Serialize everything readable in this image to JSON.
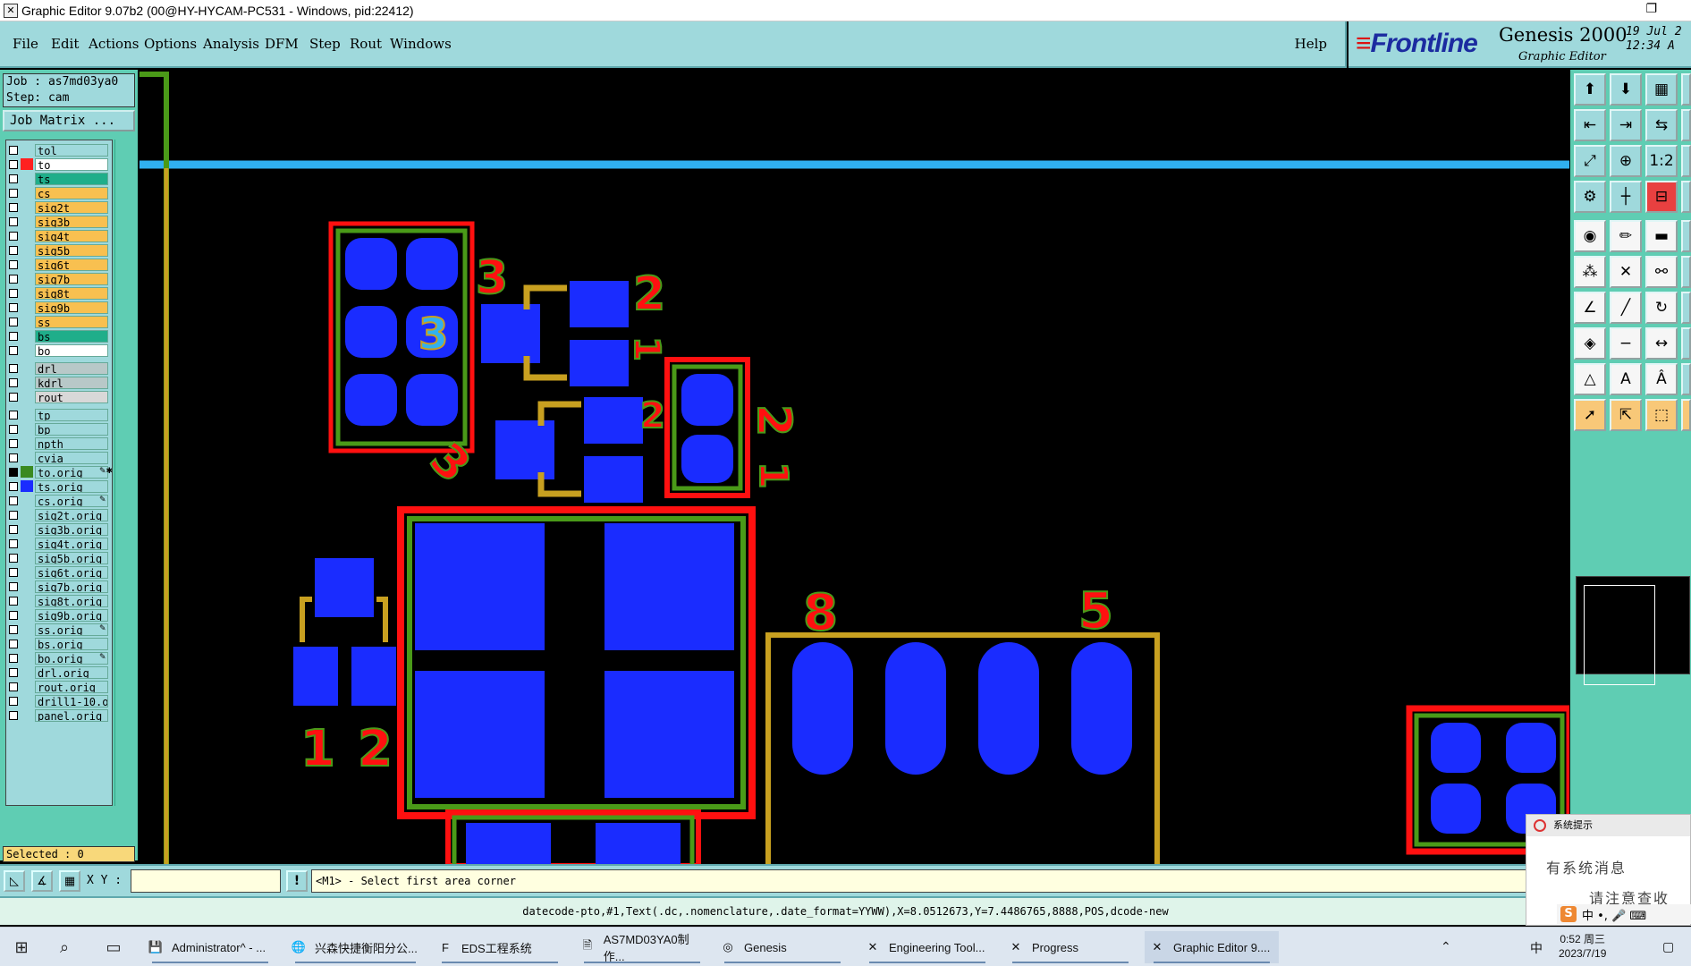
{
  "window": {
    "title": "Graphic Editor 9.07b2 (00@HY-HYCAM-PC531 - Windows, pid:22412)",
    "app_icon": "x-cross-icon",
    "restore_glyph": "❐"
  },
  "menu": {
    "items": [
      {
        "label": "File"
      },
      {
        "label": "Edit"
      },
      {
        "label": "Actions"
      },
      {
        "label": "Options"
      },
      {
        "label": "Analysis"
      },
      {
        "label": "DFM"
      },
      {
        "label": "Step"
      },
      {
        "label": "Rout"
      },
      {
        "label": "Windows"
      }
    ],
    "help": "Help"
  },
  "brand": {
    "logo": "Frontline",
    "product": "Genesis 2000",
    "subtitle": "Graphic Editor",
    "date_line1": "19 Jul 2",
    "date_line2": "12:34 A"
  },
  "left": {
    "job_line": "Job : as7md03ya0",
    "step_line": "Step: cam",
    "matrix_button": "Job Matrix ...",
    "selected": "Selected : 0",
    "layers": [
      {
        "name": "tol",
        "bg": "#9fd9dc",
        "swatch": "#9fd9dc",
        "checked": false
      },
      {
        "name": "to",
        "bg": "#ffffff",
        "swatch": "#ff2020",
        "checked": false
      },
      {
        "name": "ts",
        "bg": "#1fae8a",
        "swatch": "#9fd9dc",
        "checked": false
      },
      {
        "name": "cs",
        "bg": "#f8c050",
        "swatch": "#9fd9dc",
        "checked": false
      },
      {
        "name": "sig2t",
        "bg": "#f8c050",
        "swatch": "#9fd9dc",
        "checked": false
      },
      {
        "name": "sig3b",
        "bg": "#f8c050",
        "swatch": "#9fd9dc",
        "checked": false
      },
      {
        "name": "sig4t",
        "bg": "#f8c050",
        "swatch": "#9fd9dc",
        "checked": false
      },
      {
        "name": "sig5b",
        "bg": "#f8c050",
        "swatch": "#9fd9dc",
        "checked": false
      },
      {
        "name": "sig6t",
        "bg": "#f8c050",
        "swatch": "#9fd9dc",
        "checked": false
      },
      {
        "name": "sig7b",
        "bg": "#f8c050",
        "swatch": "#9fd9dc",
        "checked": false
      },
      {
        "name": "sig8t",
        "bg": "#f8c050",
        "swatch": "#9fd9dc",
        "checked": false
      },
      {
        "name": "sig9b",
        "bg": "#f8c050",
        "swatch": "#9fd9dc",
        "checked": false
      },
      {
        "name": "ss",
        "bg": "#f8c050",
        "swatch": "#9fd9dc",
        "checked": false
      },
      {
        "name": "bs",
        "bg": "#1fae8a",
        "swatch": "#9fd9dc",
        "checked": false
      },
      {
        "name": "bo",
        "bg": "#ffffff",
        "swatch": "#9fd9dc",
        "checked": false
      },
      {
        "name": "drl",
        "bg": "#b8c8c8",
        "swatch": "#9fd9dc",
        "checked": false,
        "gap": true
      },
      {
        "name": "kdrl",
        "bg": "#b8c8c8",
        "swatch": "#9fd9dc",
        "checked": false
      },
      {
        "name": "rout",
        "bg": "#d8d8d8",
        "swatch": "#9fd9dc",
        "checked": false
      },
      {
        "name": "tp",
        "bg": "#9fd9dc",
        "swatch": "#9fd9dc",
        "checked": false,
        "gap": true
      },
      {
        "name": "bp",
        "bg": "#9fd9dc",
        "swatch": "#9fd9dc",
        "checked": false
      },
      {
        "name": "npth",
        "bg": "#9fd9dc",
        "swatch": "#9fd9dc",
        "checked": false
      },
      {
        "name": "cvia",
        "bg": "#9fd9dc",
        "swatch": "#9fd9dc",
        "checked": false
      },
      {
        "name": "to.orig",
        "bg": "#9fd9dc",
        "swatch": "#3a8a20",
        "checked": true,
        "mark": "✎✱"
      },
      {
        "name": "ts.orig",
        "bg": "#9fd9dc",
        "swatch": "#1a2cff",
        "checked": false
      },
      {
        "name": "cs.orig",
        "bg": "#9fd9dc",
        "swatch": "#9fd9dc",
        "checked": false,
        "mark": "✎"
      },
      {
        "name": "sig2t.orig",
        "bg": "#9fd9dc",
        "swatch": "#9fd9dc",
        "checked": false
      },
      {
        "name": "sig3b.orig",
        "bg": "#9fd9dc",
        "swatch": "#9fd9dc",
        "checked": false
      },
      {
        "name": "sig4t.orig",
        "bg": "#9fd9dc",
        "swatch": "#9fd9dc",
        "checked": false
      },
      {
        "name": "sig5b.orig",
        "bg": "#9fd9dc",
        "swatch": "#9fd9dc",
        "checked": false
      },
      {
        "name": "sig6t.orig",
        "bg": "#9fd9dc",
        "swatch": "#9fd9dc",
        "checked": false
      },
      {
        "name": "sig7b.orig",
        "bg": "#9fd9dc",
        "swatch": "#9fd9dc",
        "checked": false
      },
      {
        "name": "sig8t.orig",
        "bg": "#9fd9dc",
        "swatch": "#9fd9dc",
        "checked": false
      },
      {
        "name": "sig9b.orig",
        "bg": "#9fd9dc",
        "swatch": "#9fd9dc",
        "checked": false
      },
      {
        "name": "ss.orig",
        "bg": "#9fd9dc",
        "swatch": "#9fd9dc",
        "checked": false,
        "mark": "✎"
      },
      {
        "name": "bs.orig",
        "bg": "#9fd9dc",
        "swatch": "#9fd9dc",
        "checked": false
      },
      {
        "name": "bo.orig",
        "bg": "#9fd9dc",
        "swatch": "#9fd9dc",
        "checked": false,
        "mark": "✎"
      },
      {
        "name": "drl.orig",
        "bg": "#9fd9dc",
        "swatch": "#9fd9dc",
        "checked": false
      },
      {
        "name": "rout.orig",
        "bg": "#9fd9dc",
        "swatch": "#9fd9dc",
        "checked": false
      },
      {
        "name": "drill1-10.o",
        "bg": "#9fd9dc",
        "swatch": "#9fd9dc",
        "checked": false
      },
      {
        "name": "panel.orig",
        "bg": "#9fd9dc",
        "swatch": "#9fd9dc",
        "checked": false
      }
    ]
  },
  "canvas": {
    "pin_numbers": [
      "3",
      "2",
      "1",
      "2",
      "3",
      "2",
      "1",
      "3",
      "8",
      "5",
      "1",
      "2"
    ],
    "colors": {
      "pad": "#1a2cff",
      "solder_mask": "#ff1010",
      "silkscreen": "#c8a020",
      "overlay": "#4a9a18",
      "ruler": "#30b0f0"
    }
  },
  "righttoolbar": {
    "buttons": [
      {
        "icon": "layer-up-icon",
        "glyph": "⬆"
      },
      {
        "icon": "layer-down-icon",
        "glyph": "⬇"
      },
      {
        "icon": "grid-icon",
        "glyph": "▦"
      },
      {
        "icon": "flip-left-icon",
        "glyph": "⇤"
      },
      {
        "icon": "flip-right-icon",
        "glyph": "⇥"
      },
      {
        "icon": "mirror-icon",
        "glyph": "⇆"
      },
      {
        "icon": "fit-icon",
        "glyph": "⤢"
      },
      {
        "icon": "zoom-icon",
        "glyph": "⊕"
      },
      {
        "icon": "scale-1-2-icon",
        "glyph": "1:2"
      },
      {
        "icon": "tools-icon",
        "glyph": "⚙"
      },
      {
        "icon": "cross-grid-icon",
        "glyph": "┼"
      },
      {
        "icon": "measure-icon",
        "glyph": "⊟"
      },
      {
        "icon": "camera-icon",
        "glyph": "◉"
      },
      {
        "icon": "pen-icon",
        "glyph": "✏"
      },
      {
        "icon": "ruler-icon",
        "glyph": "▬"
      },
      {
        "icon": "node-icon",
        "glyph": "⁂"
      },
      {
        "icon": "cross-icon",
        "glyph": "✕"
      },
      {
        "icon": "link-icon",
        "glyph": "⚯"
      },
      {
        "icon": "angle-icon",
        "glyph": "∠"
      },
      {
        "icon": "line-icon",
        "glyph": "╱"
      },
      {
        "icon": "arc-icon",
        "glyph": "↻"
      },
      {
        "icon": "pad-add-icon",
        "glyph": "◈"
      },
      {
        "icon": "minus-icon",
        "glyph": "−"
      },
      {
        "icon": "width-icon",
        "glyph": "↔"
      },
      {
        "icon": "triangle-icon",
        "glyph": "△"
      },
      {
        "icon": "text-a-icon",
        "glyph": "A"
      },
      {
        "icon": "text-a2-icon",
        "glyph": "Â"
      },
      {
        "icon": "pointer-icon",
        "glyph": "➚"
      },
      {
        "icon": "select-icon",
        "glyph": "⇱"
      },
      {
        "icon": "select-area-icon",
        "glyph": "⬚"
      }
    ]
  },
  "command": {
    "xy_label": "X Y :",
    "xy_value": "",
    "prompt": "<M1> - Select first area corner",
    "status": "datecode-pto,#1,Text(.dc,.nomenclature,.date_format=YYWW),X=8.0512673,Y=7.4486765,8888,POS,dcode-new"
  },
  "popup": {
    "title": "系统提示",
    "line1": "有系统消息",
    "line2": "请注意查收",
    "ime_glyph": "S",
    "ime_text": "中 •, 🎤 ⌨"
  },
  "taskbar": {
    "items": [
      {
        "label": "Administrator^ - ...",
        "icon": "💾"
      },
      {
        "label": "兴森快捷衡阳分公...",
        "icon": "🌐"
      },
      {
        "label": "EDS工程系统",
        "icon": "F"
      },
      {
        "label": "AS7MD03YA0制作...",
        "icon": "🗎"
      },
      {
        "label": "Genesis",
        "icon": "◎"
      },
      {
        "label": "Engineering Tool...",
        "icon": "✕"
      },
      {
        "label": "Progress",
        "icon": "✕"
      },
      {
        "label": "Graphic Editor 9....",
        "icon": "✕"
      }
    ],
    "clock_time": "0:52 周三",
    "clock_date": "2023/7/19",
    "ime": "中"
  }
}
